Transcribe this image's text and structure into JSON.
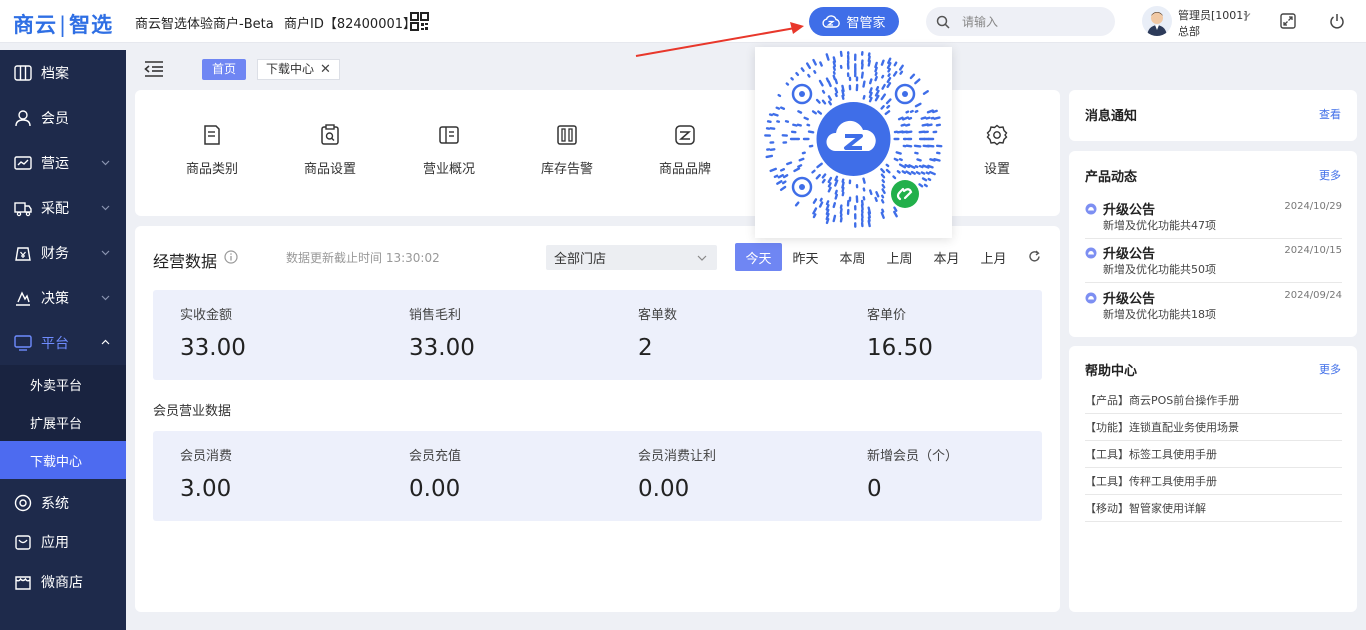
{
  "header": {
    "logo_left": "商云",
    "logo_right": "智选",
    "merchant_name": "商云智选体验商户-Beta",
    "merchant_id": "商户ID【82400001】",
    "assistant_button": "智管家",
    "search_placeholder": "请输入",
    "admin_name": "管理员[1001]",
    "admin_org": "总部"
  },
  "sidebar": {
    "items": [
      {
        "label": "档案",
        "icon": "archive-icon"
      },
      {
        "label": "会员",
        "icon": "user-icon"
      },
      {
        "label": "营运",
        "icon": "operation-icon"
      },
      {
        "label": "采配",
        "icon": "truck-icon"
      },
      {
        "label": "财务",
        "icon": "finance-icon"
      },
      {
        "label": "决策",
        "icon": "decision-icon"
      },
      {
        "label": "平台",
        "icon": "monitor-icon"
      },
      {
        "label": "系统",
        "icon": "system-icon"
      },
      {
        "label": "应用",
        "icon": "app-icon"
      },
      {
        "label": "微商店",
        "icon": "shop-icon"
      }
    ],
    "platform_sub": [
      "外卖平台",
      "扩展平台",
      "下载中心"
    ]
  },
  "tabs": {
    "home": "首页",
    "current": "下载中心",
    "close": "✕"
  },
  "shortcuts": [
    "商品类别",
    "商品设置",
    "营业概况",
    "库存告警",
    "商品品牌",
    "设置"
  ],
  "business": {
    "title": "经营数据",
    "update_time": "数据更新截止时间 13:30:02",
    "store_select": "全部门店",
    "periods": [
      "今天",
      "昨天",
      "本周",
      "上周",
      "本月",
      "上月"
    ],
    "stats": [
      {
        "label": "实收金额",
        "value": "33.00"
      },
      {
        "label": "销售毛利",
        "value": "33.00"
      },
      {
        "label": "客单数",
        "value": "2"
      },
      {
        "label": "客单价",
        "value": "16.50"
      }
    ],
    "member_title": "会员营业数据",
    "member_stats": [
      {
        "label": "会员消费",
        "value": "3.00"
      },
      {
        "label": "会员充值",
        "value": "0.00"
      },
      {
        "label": "会员消费让利",
        "value": "0.00"
      },
      {
        "label": "新增会员（个）",
        "value": "0"
      }
    ]
  },
  "notice": {
    "title": "消息通知",
    "link": "查看"
  },
  "dynamics": {
    "title": "产品动态",
    "link": "更多",
    "items": [
      {
        "title": "升级公告",
        "date": "2024/10/29",
        "desc": "新增及优化功能共47项"
      },
      {
        "title": "升级公告",
        "date": "2024/10/15",
        "desc": "新增及优化功能共50项"
      },
      {
        "title": "升级公告",
        "date": "2024/09/24",
        "desc": "新增及优化功能共18项"
      }
    ]
  },
  "help": {
    "title": "帮助中心",
    "link": "更多",
    "items": [
      "【产品】商云POS前台操作手册",
      "【功能】连锁直配业务使用场景",
      "【工具】标签工具使用手册",
      "【工具】传秤工具使用手册",
      "【移动】智管家使用详解"
    ]
  },
  "colors": {
    "primary": "#3f6ee8",
    "sidebar": "#1e2a4b",
    "active_tab": "#6f86f3",
    "arrow": "#e8372b"
  }
}
